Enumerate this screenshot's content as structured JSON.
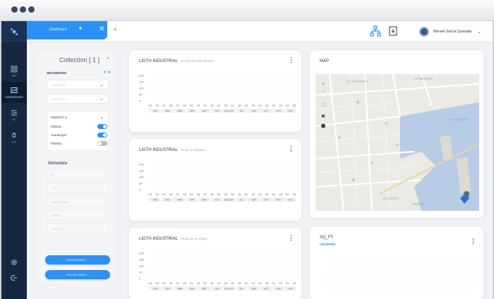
{
  "chrome": {
    "dots": 3
  },
  "rail": {
    "items": [
      {
        "name": "rail-item-grid",
        "label": "KPI",
        "icon": "grid-icon"
      },
      {
        "name": "rail-item-dashboard",
        "label": "DASHBOARD",
        "icon": "image-chart-icon"
      },
      {
        "name": "rail-item-sliders",
        "label": "PV",
        "icon": "sliders-icon"
      },
      {
        "name": "rail-item-plug",
        "label": "IoT",
        "icon": "plug-icon"
      }
    ],
    "bottom": [
      {
        "name": "settings-icon"
      },
      {
        "name": "logout-icon"
      }
    ]
  },
  "topbar": {
    "tab_label": "Dashboard",
    "tab_close": "✕",
    "tab_add": "+",
    "user_name": "Manuel Garcia Quesada",
    "user_chevron": "⌄"
  },
  "filters": {
    "title": "Collection [ 1 ]",
    "chevron": "⌃",
    "sequences_label": "SECUENCES",
    "sequences_icons": "▼ ⚙",
    "selects": [
      "ENERGY 1",
      "ENERGY 2"
    ],
    "energy_box": {
      "title": "ENERGY 3",
      "toggles": [
        {
          "label": "Olleiras",
          "on": true
        },
        {
          "label": "Carraixque",
          "on": true
        },
        {
          "label": "Palmita",
          "on": false
        }
      ]
    },
    "metadata_title": "Metadata",
    "metadata_fields": [
      "ID",
      "TST",
      "TIME_ZONE",
      "SHAPE",
      "SQ_FOOT"
    ],
    "buttons": [
      "COLLECTION 2",
      "COLLECTION 3"
    ]
  },
  "cards": {
    "chart1": {
      "title": "LIGTH INDUSTRIAL",
      "subtitle": "Ca tres un mar mentira"
    },
    "chart2": {
      "title": "LIGTH INDUSTRIAL",
      "subtitle": "Ao de la ribadera"
    },
    "chart3": {
      "title": "LIGTH INDUSTRIAL",
      "subtitle": "Pesca de la Virgen"
    },
    "map": {
      "title": "MAP",
      "labels": [
        "LA TRAVESIA",
        "LA MERCED",
        "LA MACOSTA",
        "EL ROSTO",
        "PUERTO"
      ],
      "controls": [
        "+",
        "−",
        "⬚",
        "▣",
        "⬤"
      ]
    },
    "sqft": {
      "title": "SQ_FT",
      "subtitle": "CROPPER"
    },
    "kebab": "⋮"
  },
  "chart_data": [
    {
      "type": "line",
      "yticks": [
        200,
        150,
        100,
        50,
        0
      ],
      "x_days": [
        "01",
        "15",
        "01",
        "15",
        "01",
        "15",
        "01",
        "15",
        "01",
        "15",
        "01",
        "15",
        "01",
        "15",
        "01",
        "15",
        "01",
        "15",
        "01",
        "15",
        "01",
        "15"
      ],
      "x_months": [
        "JAN",
        "FEB",
        "MAR",
        "APR",
        "MAY",
        "JUN",
        "AUGUST",
        "JUL",
        "SEP",
        "OCT",
        "NOV",
        "DEC"
      ]
    },
    {
      "type": "line",
      "yticks": [
        200,
        150,
        100,
        50,
        0
      ],
      "x_days": [
        "01",
        "15",
        "01",
        "15",
        "01",
        "15",
        "01",
        "15",
        "01",
        "15",
        "01",
        "15",
        "01",
        "15",
        "01",
        "15",
        "01",
        "15",
        "01",
        "15",
        "01",
        "15"
      ],
      "x_months": [
        "JAN",
        "FEB",
        "MAR",
        "APR",
        "MAY",
        "JUN",
        "AUGUST",
        "JUL",
        "SEP",
        "OCT",
        "NOV",
        "DEC"
      ]
    },
    {
      "type": "line",
      "yticks": [
        200,
        150,
        100,
        50,
        0
      ],
      "x_days": [
        "01",
        "15",
        "01",
        "15",
        "01",
        "15",
        "01",
        "15",
        "01",
        "15",
        "01",
        "15",
        "01",
        "15",
        "01",
        "15",
        "01",
        "15",
        "01",
        "15",
        "01",
        "15"
      ],
      "x_months": [
        "JAN",
        "FEB",
        "MAR",
        "APR",
        "MAY",
        "JUN",
        "AUGUST",
        "JUL",
        "SEP",
        "OCT",
        "NOV",
        "DEC"
      ]
    }
  ]
}
